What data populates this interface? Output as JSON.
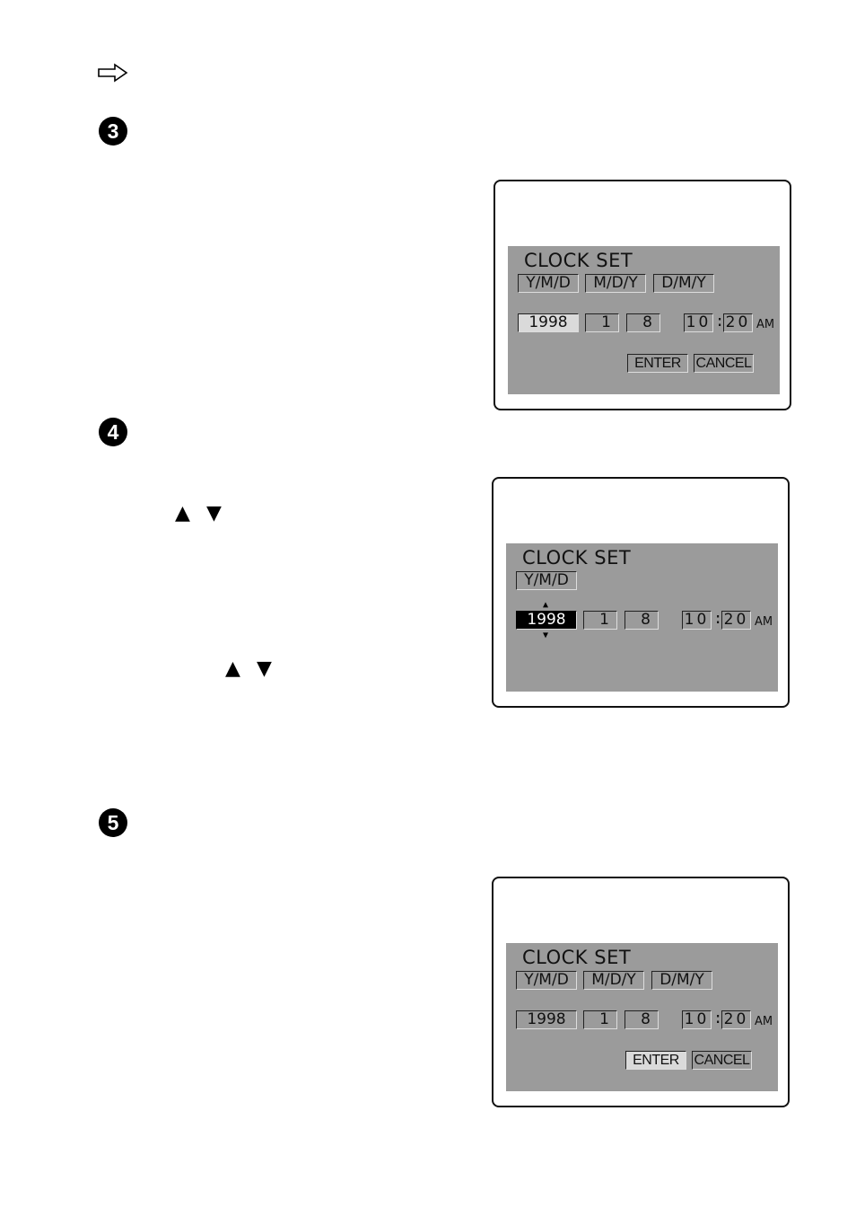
{
  "page": {
    "arrow_glyph": "⇨",
    "steps": [
      {
        "number": "3"
      },
      {
        "number": "4"
      },
      {
        "number": "5"
      }
    ],
    "step4_arrows": [
      {
        "up": "▲",
        "down": "▼"
      },
      {
        "up": "▲",
        "down": "▼"
      }
    ]
  },
  "screens": [
    {
      "title": "CLOCK SET",
      "formats": [
        "Y/M/D",
        "M/D/Y",
        "D/M/Y"
      ],
      "year": "1998",
      "month": "1",
      "day": "8",
      "hour": "10",
      "minute": "20",
      "ampm": "AM",
      "colon": ":",
      "enter_label": "ENTER",
      "cancel_label": "CANCEL",
      "highlighted": "year"
    },
    {
      "title": "CLOCK SET",
      "formats": [
        "Y/M/D"
      ],
      "year": "1998",
      "month": "1",
      "day": "8",
      "hour": "10",
      "minute": "20",
      "ampm": "AM",
      "colon": ":",
      "selected": "year",
      "spin_up": "▲",
      "spin_down": "▼"
    },
    {
      "title": "CLOCK SET",
      "formats": [
        "Y/M/D",
        "M/D/Y",
        "D/M/Y"
      ],
      "year": "1998",
      "month": "1",
      "day": "8",
      "hour": "10",
      "minute": "20",
      "ampm": "AM",
      "colon": ":",
      "enter_label": "ENTER",
      "cancel_label": "CANCEL",
      "highlighted": "enter"
    }
  ],
  "colors": {
    "panel_gray": "#9b9b9b",
    "highlight": "#dadada",
    "selected_bg": "#000000"
  }
}
